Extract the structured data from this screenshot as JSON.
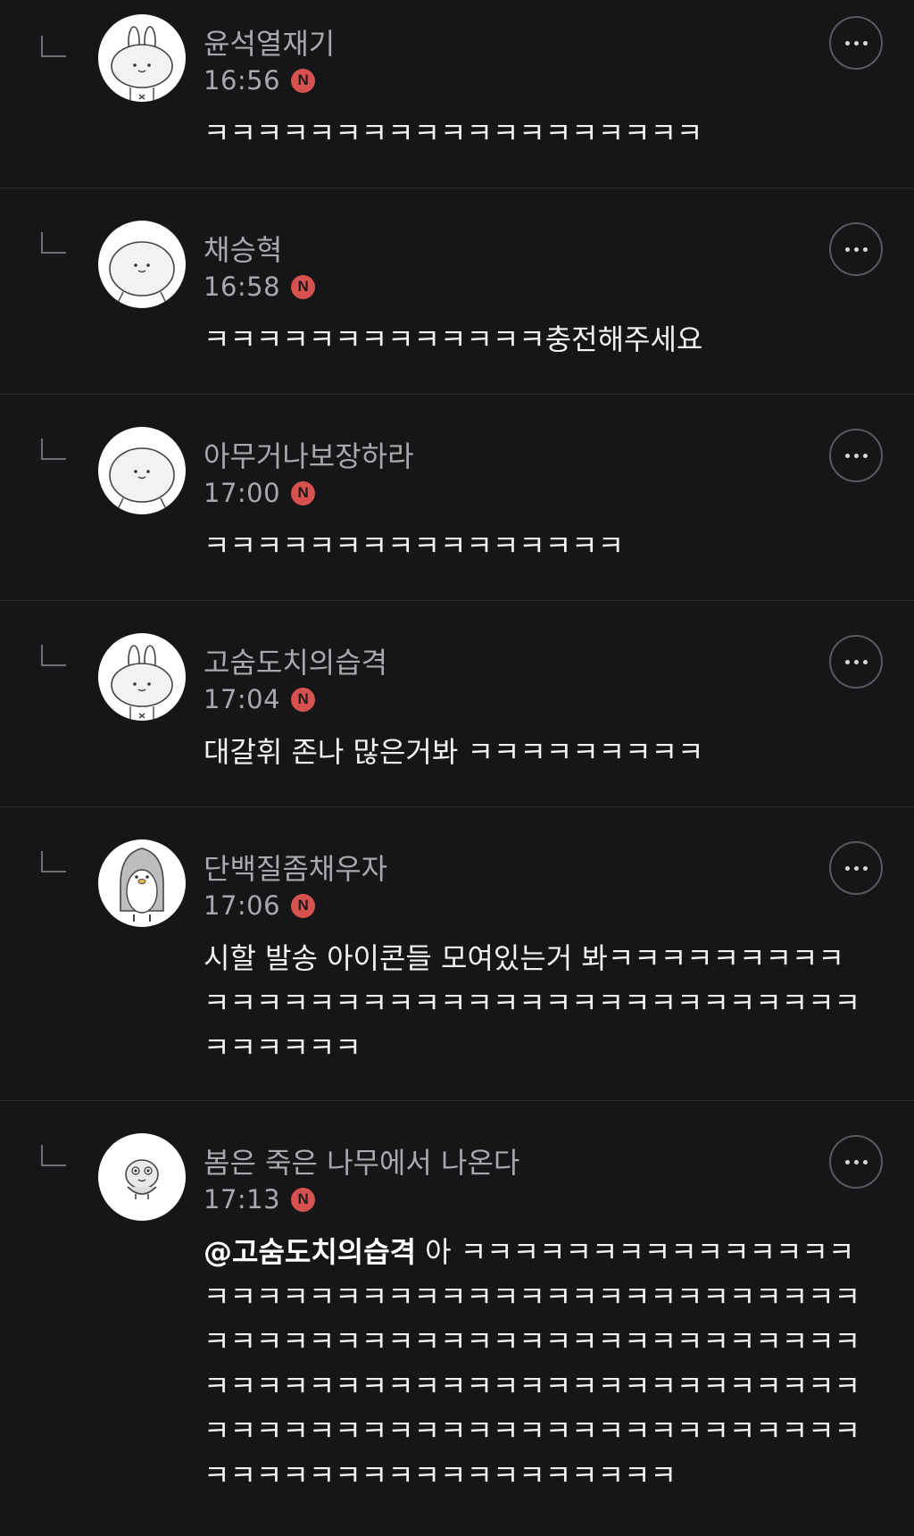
{
  "colors": {
    "background": "#161618",
    "divider": "#2c2c2f",
    "author_text": "#a9a9ad",
    "body_text": "#f2f2f4",
    "new_badge": "#d7514f"
  },
  "comments": [
    {
      "author": "윤석열재기",
      "time": "16:56",
      "badge": "N",
      "avatar": "rabbit-avatar",
      "mention": "",
      "text": "ㅋㅋㅋㅋㅋㅋㅋㅋㅋㅋㅋㅋㅋㅋㅋㅋㅋㅋㅋ"
    },
    {
      "author": "채승혁",
      "time": "16:58",
      "badge": "N",
      "avatar": "round-face-avatar",
      "mention": "",
      "text": "ㅋㅋㅋㅋㅋㅋㅋㅋㅋㅋㅋㅋㅋ충전해주세요"
    },
    {
      "author": "아무거나보장하라",
      "time": "17:00",
      "badge": "N",
      "avatar": "round-face-avatar",
      "mention": "",
      "text": "ㅋㅋㅋㅋㅋㅋㅋㅋㅋㅋㅋㅋㅋㅋㅋㅋ"
    },
    {
      "author": "고숨도치의습격",
      "time": "17:04",
      "badge": "N",
      "avatar": "rabbit-avatar",
      "mention": "",
      "text": "대갈휘 존나 많은거봐 ㅋㅋㅋㅋㅋㅋㅋㅋㅋ"
    },
    {
      "author": "단백질좀채우자",
      "time": "17:06",
      "badge": "N",
      "avatar": "penguin-avatar",
      "mention": "",
      "text": "시할 발송 아이콘들 모여있는거 봐ㅋㅋㅋㅋㅋㅋㅋㅋㅋㅋㅋㅋㅋㅋㅋㅋㅋㅋㅋㅋㅋㅋㅋㅋㅋㅋㅋㅋㅋㅋㅋㅋㅋㅋㅋㅋㅋㅋㅋㅋ"
    },
    {
      "author": "봄은 죽은 나무에서 나온다",
      "time": "17:13",
      "badge": "N",
      "avatar": "bird-avatar",
      "mention": "@고숨도치의습격",
      "text": "아 ㅋㅋㅋㅋㅋㅋㅋㅋㅋㅋㅋㅋㅋㅋㅋㅋㅋㅋㅋㅋㅋㅋㅋㅋㅋㅋㅋㅋㅋㅋㅋㅋㅋㅋㅋㅋㅋㅋㅋㅋㅋㅋㅋㅋㅋㅋㅋㅋㅋㅋㅋㅋㅋㅋㅋㅋㅋㅋㅋㅋㅋㅋㅋㅋㅋㅋㅋㅋㅋㅋㅋㅋㅋㅋㅋㅋㅋㅋㅋㅋㅋㅋㅋㅋㅋㅋㅋㅋㅋㅋㅋㅋㅋㅋㅋㅋㅋㅋㅋㅋㅋㅋㅋㅋㅋㅋㅋㅋㅋㅋㅋㅋㅋㅋㅋㅋㅋㅋㅋㅋㅋㅋㅋㅋㅋㅋㅋㅋㅋㅋㅋㅋㅋ"
    }
  ]
}
